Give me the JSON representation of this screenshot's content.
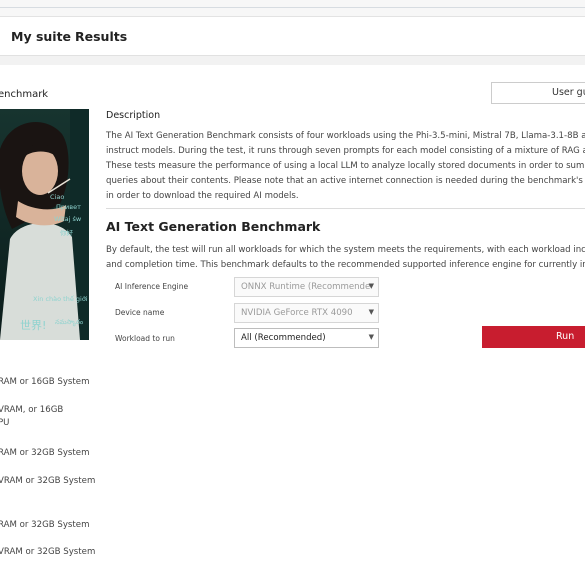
{
  "nav": {
    "tabs": [
      {
        "label": "My suite"
      },
      {
        "label": "Results"
      }
    ]
  },
  "benchmark_title": "enchmark",
  "hero_words": [
    "Ciao",
    "Привет",
    "Witaj św",
    "你好",
    "Xin chào thế giới",
    "世界!",
    "నమస్కారం"
  ],
  "user_guide_label": "User gui",
  "description": {
    "heading": "Description",
    "lines": [
      "The AI Text Generation Benchmark consists of four workloads using the Phi-3.5-mini, Mistral 7B, Llama-3.1-8B and L",
      "instruct models. During the test, it runs through seven prompts for each model consisting of a mixture of RAG and n",
      "These tests measure the performance of using a local LLM to analyze locally stored documents in order to summariz",
      "queries about their contents. Please note that an active internet connection is needed during the benchmark's first r",
      "in order to download the required AI models."
    ]
  },
  "ai": {
    "title": "AI Text Generation Benchmark",
    "intro_lines": [
      "By default, the test will run all workloads for which the system meets the requirements, with each workload increasi",
      "and completion time. This benchmark defaults to the recommended supported inference engine for currently instal"
    ]
  },
  "form": {
    "engine_label": "AI Inference Engine",
    "engine_value": "ONNX Runtime (Recommende",
    "device_label": "Device name",
    "device_value": "NVIDIA GeForce RTX 4090",
    "workload_label": "Workload to run",
    "workload_value": "All (Recommended)",
    "run_label": "Run"
  },
  "requirements": [
    "RAM or 16GB System",
    "VRAM, or 16GB",
    "PU",
    "RAM or 32GB System",
    "VRAM or 32GB System",
    "RAM or 32GB System",
    "VRAM or 32GB System"
  ],
  "colors": {
    "accent": "#c81d2f",
    "panel": "#ffffff",
    "page": "#f2f2f2"
  }
}
